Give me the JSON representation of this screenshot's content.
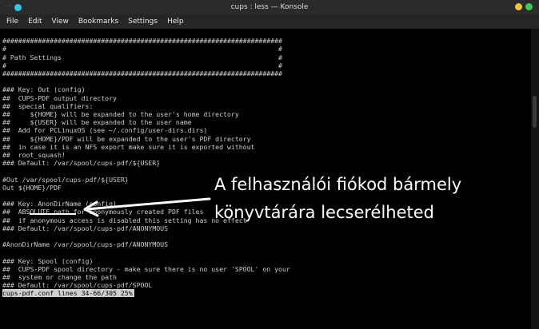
{
  "window": {
    "title": "cups : less — Konsole",
    "pin_glyph": "⁻⁼"
  },
  "menubar": {
    "items": [
      "File",
      "Edit",
      "View",
      "Bookmarks",
      "Settings",
      "Help"
    ]
  },
  "terminal": {
    "lines": [
      "",
      "#######################################################################",
      "#                                                                     #",
      "# Path Settings                                                       #",
      "#                                                                     #",
      "#######################################################################",
      "",
      "### Key: Out (config)",
      "##  CUPS-PDF output directory",
      "##  special qualifiers:",
      "##     ${HOME} will be expanded to the user's home directory",
      "##     ${USER} will be expanded to the user name",
      "##  Add for PCLinuxOS (see ~/.config/user-dirs.dirs)",
      "##     ${HOME}/PDF will be expanded to the user's PDF directory",
      "##  in case it is an NFS export make sure it is exported without",
      "##  root_squash!",
      "### Default: /var/spool/cups-pdf/${USER}",
      "",
      "#Out /var/spool/cups-pdf/${USER}",
      "Out ${HOME}/PDF",
      "",
      "### Key: AnonDirName (config)",
      "##  ABSOLUTE path for anonymously created PDF files",
      "##  if anonymous access is disabled this setting has no effect",
      "### Default: /var/spool/cups-pdf/ANONYMOUS",
      "",
      "#AnonDirName /var/spool/cups-pdf/ANONYMOUS",
      "",
      "### Key: Spool (config)",
      "##  CUPS-PDF spool directory - make sure there is no user 'SPOOL' on your",
      "##  system or change the path",
      "### Default: /var/spool/cups-pdf/SPOOL"
    ],
    "status_line": "cups-pdf.conf lines 34-66/305 25%"
  },
  "annotation": {
    "line1": "A felhasználói fiókod bármely",
    "line2": "könyvtárára lecserélheted"
  },
  "scroll_position_fraction": 0.25,
  "colors": {
    "terminal_bg": "#000000",
    "terminal_fg": "#cfcfcf",
    "titlebar_bg": "#2b2b2b",
    "menubar_bg": "#262626",
    "annotation": "#ffffff"
  }
}
